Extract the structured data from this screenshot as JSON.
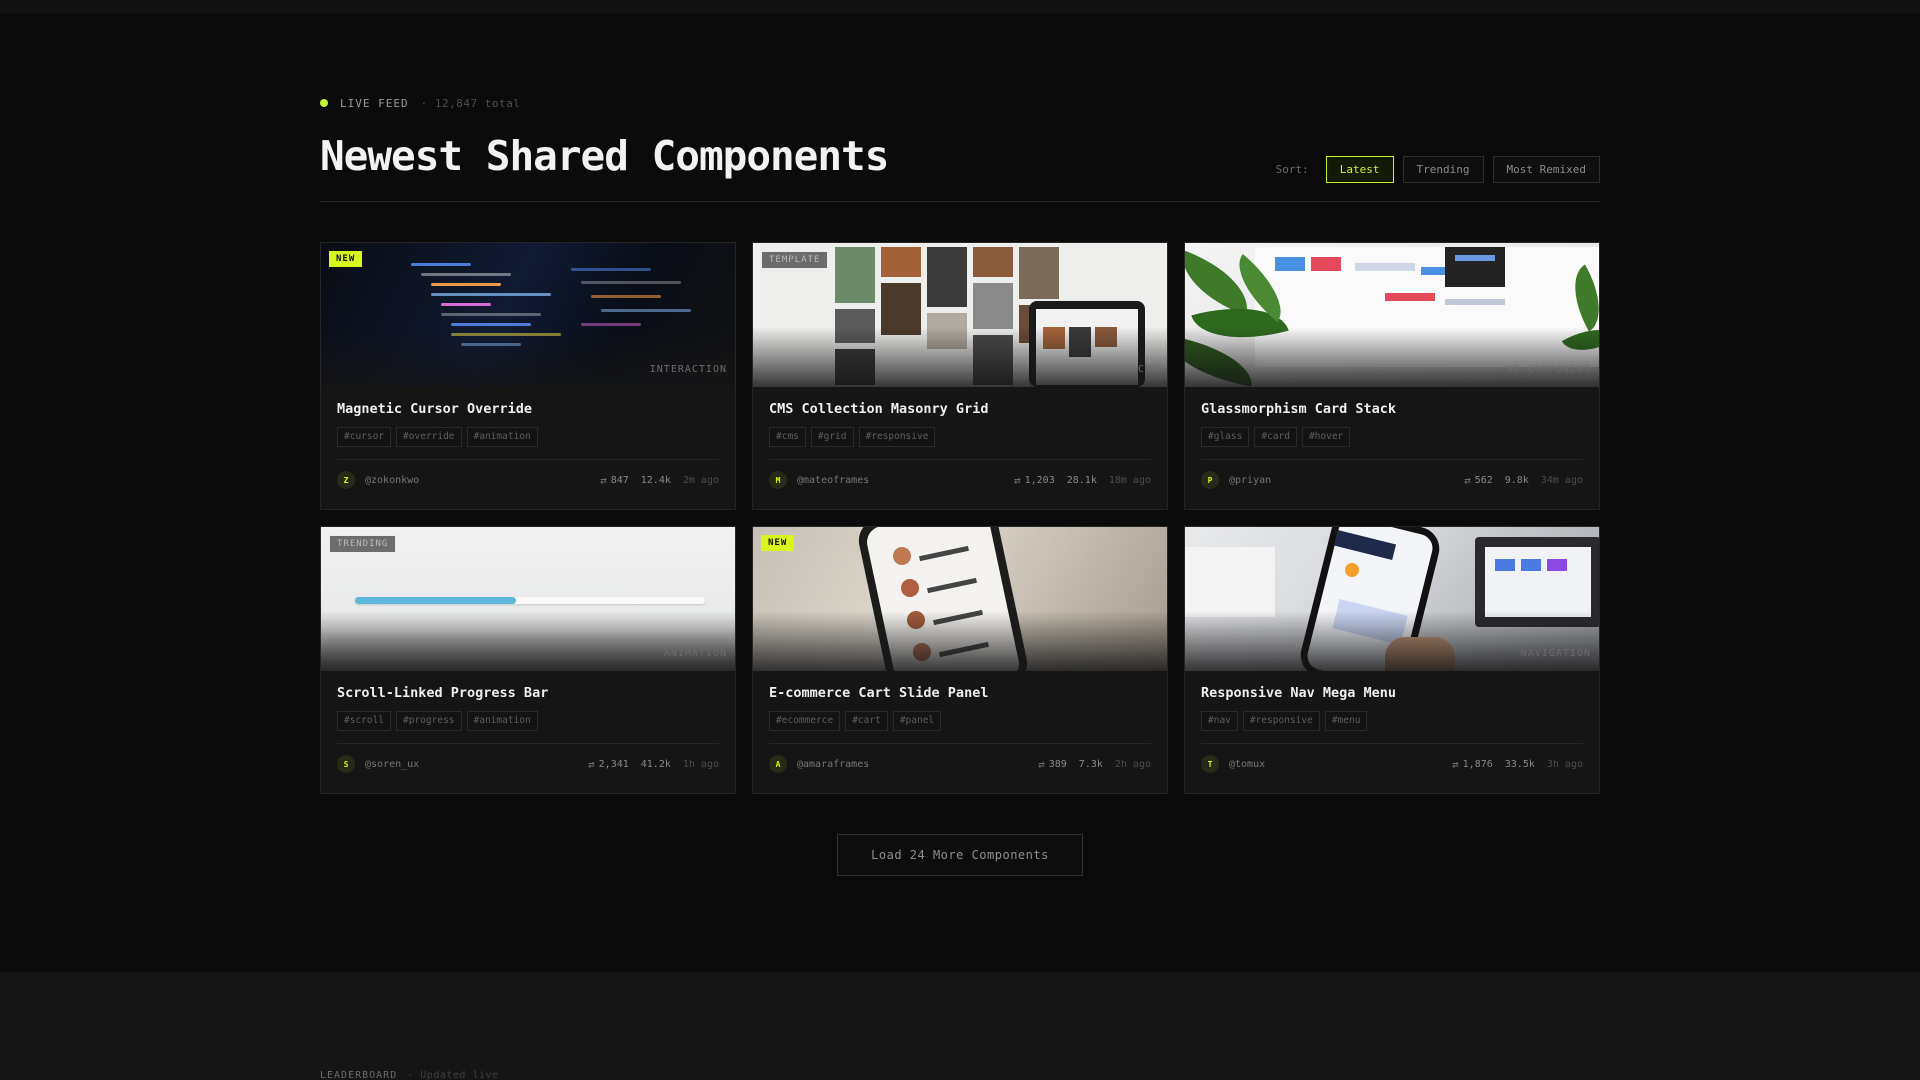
{
  "feed": {
    "label": "LIVE FEED",
    "count": "· 12,847 total"
  },
  "page_title": "Newest Shared Components",
  "sort": {
    "label": "Sort:",
    "options": [
      "Latest",
      "Trending",
      "Most Remixed"
    ],
    "selected": "Latest"
  },
  "cards": [
    {
      "badge": "NEW",
      "badge_style": "new",
      "category": "INTERACTION",
      "title": "Magnetic Cursor Override",
      "tags": [
        "#cursor",
        "#override",
        "#animation"
      ],
      "avatar": "Z",
      "author": "@zokonkwo",
      "remixes": "847",
      "views": "12.4k",
      "time": "2m ago"
    },
    {
      "badge": "TEMPLATE",
      "badge_style": "outline",
      "category": "CMS",
      "title": "CMS Collection Masonry Grid",
      "tags": [
        "#cms",
        "#grid",
        "#responsive"
      ],
      "avatar": "M",
      "author": "@mateoframes",
      "remixes": "1,203",
      "views": "28.1k",
      "time": "18m ago"
    },
    {
      "badge": "",
      "badge_style": "none",
      "category": "UI COMPONENT",
      "title": "Glassmorphism Card Stack",
      "tags": [
        "#glass",
        "#card",
        "#hover"
      ],
      "avatar": "P",
      "author": "@priyan",
      "remixes": "562",
      "views": "9.8k",
      "time": "34m ago"
    },
    {
      "badge": "TRENDING",
      "badge_style": "outline",
      "category": "ANIMATION",
      "title": "Scroll-Linked Progress Bar",
      "tags": [
        "#scroll",
        "#progress",
        "#animation"
      ],
      "avatar": "S",
      "author": "@soren_ux",
      "remixes": "2,341",
      "views": "41.2k",
      "time": "1h ago"
    },
    {
      "badge": "NEW",
      "badge_style": "new",
      "category": "",
      "title": "E-commerce Cart Slide Panel",
      "tags": [
        "#ecommerce",
        "#cart",
        "#panel"
      ],
      "avatar": "A",
      "author": "@amaraframes",
      "remixes": "389",
      "views": "7.3k",
      "time": "2h ago"
    },
    {
      "badge": "",
      "badge_style": "none",
      "category": "NAVIGATION",
      "title": "Responsive Nav Mega Menu",
      "tags": [
        "#nav",
        "#responsive",
        "#menu"
      ],
      "avatar": "T",
      "author": "@tomux",
      "remixes": "1,876",
      "views": "33.5k",
      "time": "3h ago"
    }
  ],
  "progress_demo": {
    "fill_fraction": 0.46
  },
  "load_more": "Load 24 More Components",
  "leaderboard": {
    "label": "LEADERBOARD",
    "sub": "· Updated live"
  },
  "colors": {
    "accent": "#c6f432",
    "background": "#0b0b0c",
    "card": "#151516"
  }
}
